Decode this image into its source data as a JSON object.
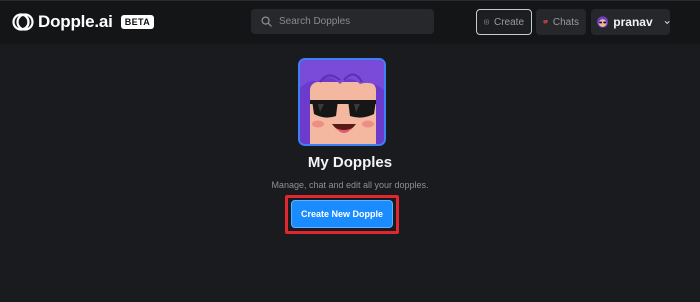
{
  "brand": {
    "name": "Dopple.ai",
    "badge": "BETA"
  },
  "search": {
    "placeholder": "Search Dopples"
  },
  "nav": {
    "create_label": "Create",
    "chats_label": "Chats"
  },
  "user": {
    "name": "pranav"
  },
  "main": {
    "title": "My Dopples",
    "subtitle": "Manage, chat and edit all your dopples.",
    "cta_label": "Create New Dopple"
  },
  "colors": {
    "background": "#1a1b1e",
    "topbar": "#141517",
    "accent": "#1a8cff",
    "highlight": "#e0262e"
  }
}
